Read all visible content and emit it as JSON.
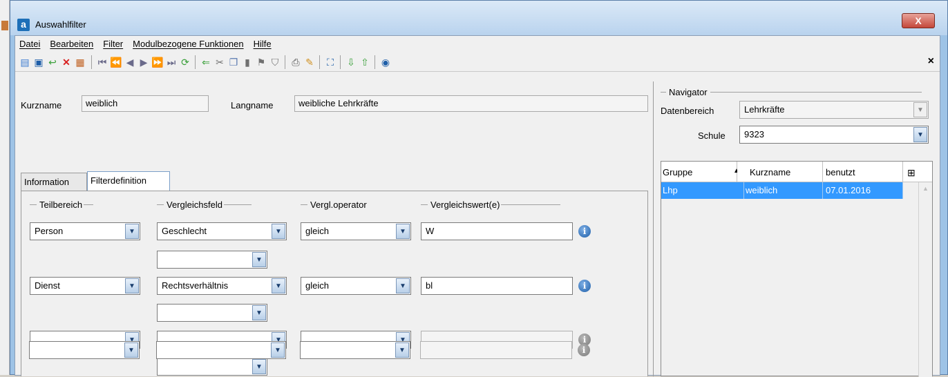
{
  "window": {
    "title": "Auswahlfilter",
    "close_glyph": "X",
    "icon_letter": "a"
  },
  "menu": [
    "Datei",
    "Bearbeiten",
    "Filter",
    "Modulbezogene Funktionen",
    "Hilfe"
  ],
  "toolbar": {
    "close_glyph": "×",
    "icons": [
      "new-icon",
      "save-icon",
      "undo-icon",
      "delete-icon",
      "edit-icon",
      "first-icon",
      "prev-page-icon",
      "prev-icon",
      "next-icon",
      "next-page-icon",
      "last-icon",
      "refresh-icon",
      "back-icon",
      "cut-icon",
      "copy-icon",
      "paste-icon",
      "paste-special-icon",
      "filter-icon",
      "print-icon",
      "clear-icon",
      "select-icon",
      "import-icon",
      "export-icon",
      "help-icon"
    ]
  },
  "header": {
    "kurzname_label": "Kurzname",
    "kurzname_value": "weiblich",
    "langname_label": "Langname",
    "langname_value": "weibliche Lehrkräfte"
  },
  "tabs": [
    {
      "label": "Information",
      "active": false
    },
    {
      "label": "Filterdefinition",
      "active": true
    }
  ],
  "filter": {
    "headers": {
      "teilbereich": "Teilbereich",
      "vergleichsfeld": "Vergleichsfeld",
      "operator": "Vergl.operator",
      "wert": "Vergleichswert(e)"
    },
    "rows": [
      {
        "teilbereich": "Person",
        "feld": "Geschlecht",
        "operator": "gleich",
        "wert": "W",
        "sub": ""
      },
      {
        "teilbereich": "Dienst",
        "feld": "Rechtsverhältnis",
        "operator": "gleich",
        "wert": "bl",
        "sub": ""
      },
      {
        "teilbereich": "",
        "feld": "",
        "operator": "",
        "wert": "",
        "sub": ""
      },
      {
        "teilbereich": "",
        "feld": "",
        "operator": "",
        "wert": ""
      }
    ]
  },
  "navigator": {
    "title": "Navigator",
    "datenbereich_label": "Datenbereich",
    "datenbereich_value": "Lehrkräfte",
    "schule_label": "Schule",
    "schule_value": "9323"
  },
  "grid": {
    "columns": [
      "Gruppe",
      "Kurzname",
      "benutzt"
    ],
    "sort_indicator": "▲",
    "rows": [
      {
        "gruppe": "Lhp",
        "kurzname": "weiblich",
        "benutzt": "07.01.2016"
      }
    ]
  },
  "colors": {
    "selection": "#3399ff",
    "info": "#1e5ea8"
  }
}
